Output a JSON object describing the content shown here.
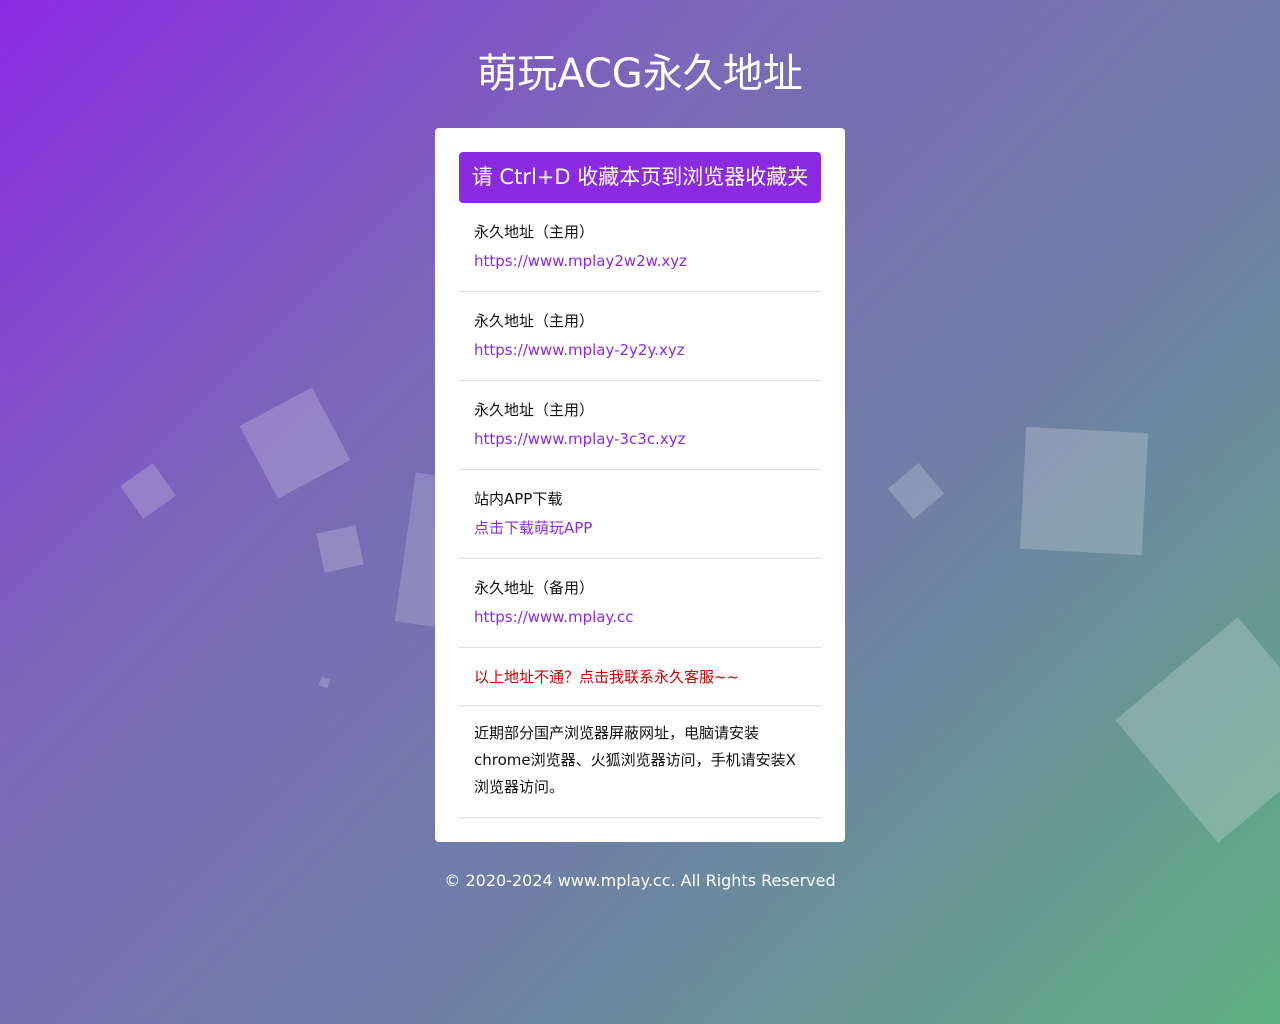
{
  "page": {
    "title": "萌玩ACG永久地址"
  },
  "card": {
    "bookmark_banner": "请 Ctrl+D 收藏本页到浏览器收藏夹",
    "items": [
      {
        "label": "永久地址（主用）",
        "link": "https://www.mplay2w2w.xyz"
      },
      {
        "label": "永久地址（主用）",
        "link": "https://www.mplay-2y2y.xyz"
      },
      {
        "label": "永久地址（主用）",
        "link": "https://www.mplay-3c3c.xyz"
      },
      {
        "label": "站内APP下载",
        "link": "点击下载萌玩APP"
      },
      {
        "label": "永久地址（备用）",
        "link": "https://www.mplay.cc"
      }
    ],
    "contact_link": "以上地址不通？点击我联系永久客服~~",
    "notice": "近期部分国产浏览器屏蔽网址，电脑请安装chrome浏览器、火狐浏览器访问，手机请安装X浏览器访问。"
  },
  "footer": {
    "copyright": "© 2020-2024 www.mplay.cc. All Rights Reserved"
  },
  "colors": {
    "accent": "#8a2be2",
    "contact": "#cc0000",
    "gradient_start": "#8a2be2",
    "gradient_end": "#60b082"
  }
}
